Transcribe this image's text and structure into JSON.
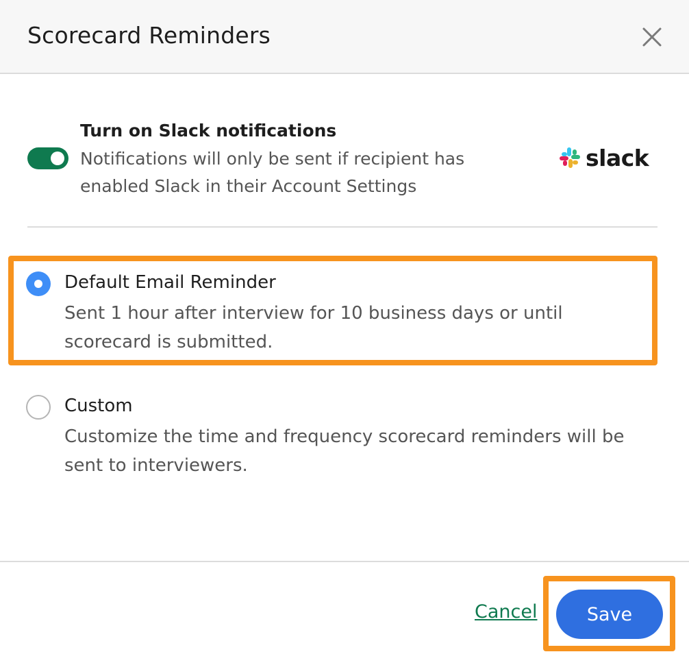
{
  "dialog": {
    "title": "Scorecard Reminders"
  },
  "slack": {
    "title": "Turn on Slack notifications",
    "description": "Notifications will only be sent if recipient has enabled Slack in their Account Settings",
    "toggle_on": true,
    "logo_text": "slack"
  },
  "options": [
    {
      "title": "Default Email Reminder",
      "description": "Sent 1 hour after interview for 10 business days or until scorecard is submitted.",
      "selected": true
    },
    {
      "title": "Custom",
      "description": "Customize the time and frequency scorecard reminders will be sent to interviewers.",
      "selected": false
    }
  ],
  "footer": {
    "cancel_label": "Cancel",
    "save_label": "Save"
  },
  "colors": {
    "toggle_on": "#0f7a4f",
    "radio_selected": "#3e8ef7",
    "save_button": "#2f6fe0",
    "cancel_link": "#0f7a4f",
    "highlight": "#f7931e"
  },
  "icons": {
    "close": "close-icon",
    "slack": "slack-logo-icon"
  }
}
